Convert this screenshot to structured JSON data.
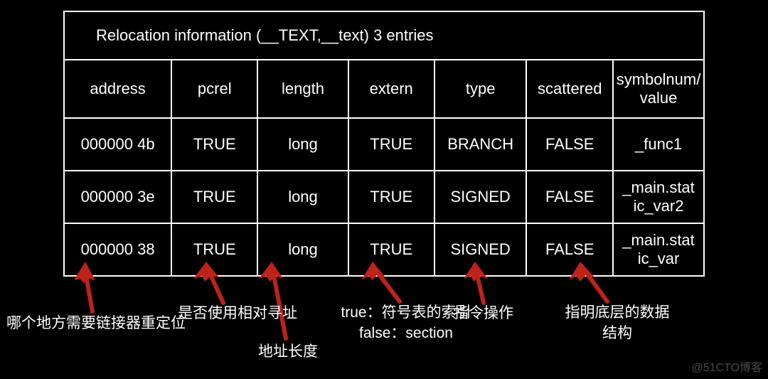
{
  "title": "Relocation information (__TEXT,__text) 3 entries",
  "headers": {
    "address": "address",
    "pcrel": "pcrel",
    "length": "length",
    "extern": "extern",
    "type": "type",
    "scattered": "scattered",
    "symbolnum": "symbolnum/\nvalue"
  },
  "rows": [
    {
      "address": "000000 4b",
      "pcrel": "TRUE",
      "length": "long",
      "extern": "TRUE",
      "type": "BRANCH",
      "scattered": "FALSE",
      "sym": "_func1"
    },
    {
      "address": "000000 3e",
      "pcrel": "TRUE",
      "length": "long",
      "extern": "TRUE",
      "type": "SIGNED",
      "scattered": "FALSE",
      "sym": "_main.stat\nic_var2"
    },
    {
      "address": "000000 38",
      "pcrel": "TRUE",
      "length": "long",
      "extern": "TRUE",
      "type": "SIGNED",
      "scattered": "FALSE",
      "sym": "_main.stat\nic_var"
    }
  ],
  "annotations": {
    "address": "哪个地方需要链接器重定位",
    "pcrel": "是否使用相对寻址",
    "length": "地址长度",
    "extern_line1": "true：符号表的索引",
    "extern_line2": "false：section",
    "type": "指令操作",
    "scattered_line1": "指明底层的数据",
    "scattered_line2": "结构"
  },
  "watermark": "@51CTO博客",
  "chart_data": {
    "type": "table",
    "title": "Relocation information (__TEXT,__text) 3 entries",
    "columns": [
      "address",
      "pcrel",
      "length",
      "extern",
      "type",
      "scattered",
      "symbolnum/value"
    ],
    "rows": [
      [
        "000000 4b",
        "TRUE",
        "long",
        "TRUE",
        "BRANCH",
        "FALSE",
        "_func1"
      ],
      [
        "000000 3e",
        "TRUE",
        "long",
        "TRUE",
        "SIGNED",
        "FALSE",
        "_main.static_var2"
      ],
      [
        "000000 38",
        "TRUE",
        "long",
        "TRUE",
        "SIGNED",
        "FALSE",
        "_main.static_var"
      ]
    ],
    "column_annotations": {
      "address": "哪个地方需要链接器重定位",
      "pcrel": "是否使用相对寻址",
      "length": "地址长度",
      "extern": "true：符号表的索引 / false：section",
      "type": "指令操作",
      "scattered": "指明底层的数据结构"
    }
  }
}
